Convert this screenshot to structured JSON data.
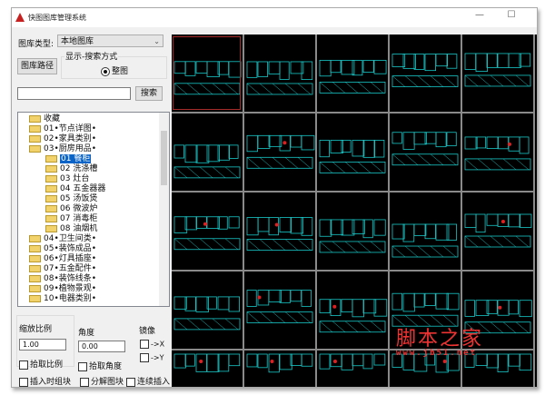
{
  "window": {
    "title": "快图图库管理系统",
    "minimize": "—",
    "maximize": "☐"
  },
  "library": {
    "type_label": "图库类型:",
    "type_value": "本地图库",
    "path_button": "图库路径"
  },
  "display": {
    "group_label": "显示-搜索方式",
    "radio_label": "整图"
  },
  "search": {
    "value": "",
    "button": "搜索"
  },
  "tree": {
    "items": [
      {
        "label": "收藏",
        "level": 0
      },
      {
        "label": "01•节点详图•",
        "level": 0
      },
      {
        "label": "02•家具类别•",
        "level": 0
      },
      {
        "label": "03•厨房用品•",
        "level": 0,
        "expanded": true
      },
      {
        "label": "01 餐柜",
        "level": 1,
        "selected": true
      },
      {
        "label": "02 洗涤槽",
        "level": 1
      },
      {
        "label": "03 灶台",
        "level": 1
      },
      {
        "label": "04 五金器器",
        "level": 1
      },
      {
        "label": "05 汤饭煲",
        "level": 1
      },
      {
        "label": "06 微波炉",
        "level": 1
      },
      {
        "label": "07 消毒柜",
        "level": 1
      },
      {
        "label": "08 油烟机",
        "level": 1
      },
      {
        "label": "04•卫生间类•",
        "level": 0
      },
      {
        "label": "05•装饰成品•",
        "level": 0
      },
      {
        "label": "06•灯具插座•",
        "level": 0
      },
      {
        "label": "07•五金配件•",
        "level": 0
      },
      {
        "label": "08•装饰线条•",
        "level": 0
      },
      {
        "label": "09•植物景观•",
        "level": 0
      },
      {
        "label": "10•电器类别•",
        "level": 0
      }
    ]
  },
  "bottom": {
    "scale_label": "缩放比例",
    "scale_value": "1.00",
    "angle_label": "角度",
    "angle_value": "0.00",
    "mirror_label": "镜像",
    "mirror_x": "->X",
    "mirror_y": "->Y",
    "pick_scale": "拾取比例",
    "pick_angle": "拾取角度",
    "group_on_insert": "插入时组块",
    "explode_block": "分解图块",
    "continuous_insert": "连续插入"
  },
  "watermark": {
    "text": "脚本之家",
    "url": "www.jb51.net"
  },
  "colors": {
    "cad_line": "#19c8c8",
    "cad_mark": "#e02020",
    "grid_bg": "#000000"
  }
}
